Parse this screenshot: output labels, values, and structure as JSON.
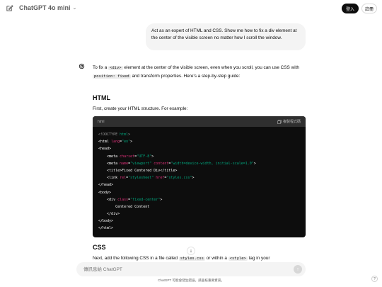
{
  "header": {
    "model_name": "ChatGPT 4o mini",
    "login_label": "登入",
    "signup_label": "註冊"
  },
  "user_message": "Act as an expert of HTML and CSS. Show me how to fix a div element at the center of the visible screen no matter how I scroll the window.",
  "answer": {
    "intro_1": "To fix a ",
    "intro_code_1": "<div>",
    "intro_2": " element at the center of the visible screen, even when you scroll, you can use CSS with ",
    "intro_code_2": "position: fixed",
    "intro_3": " and transform properties. Here's a step-by-step guide:",
    "html_heading": "HTML",
    "html_text": "First, create your HTML structure. For example:",
    "code_lang": "html",
    "copy_label": "複製程式碼",
    "css_heading": "CSS",
    "css_text_1": "Next, add the following CSS in a file called ",
    "css_code_1": "styles.css",
    "css_text_2": " or within a ",
    "css_code_2": "<style>",
    "css_text_3": " tag in your"
  },
  "code_lines": [
    [
      {
        "t": "<!DOCTYPE ",
        "c": "doc"
      },
      {
        "t": "html",
        "c": "val"
      },
      {
        "t": ">",
        "c": "doc"
      }
    ],
    [
      {
        "t": "<html ",
        "c": "tag"
      },
      {
        "t": "lang",
        "c": "attr"
      },
      {
        "t": "=",
        "c": "tag"
      },
      {
        "t": "\"en\"",
        "c": "val"
      },
      {
        "t": ">",
        "c": "tag"
      }
    ],
    [
      {
        "t": "<head>",
        "c": "tag"
      }
    ],
    [
      {
        "t": "    <meta ",
        "c": "tag"
      },
      {
        "t": "charset",
        "c": "attr"
      },
      {
        "t": "=",
        "c": "tag"
      },
      {
        "t": "\"UTF-8\"",
        "c": "val"
      },
      {
        "t": ">",
        "c": "tag"
      }
    ],
    [
      {
        "t": "    <meta ",
        "c": "tag"
      },
      {
        "t": "name",
        "c": "attr"
      },
      {
        "t": "=",
        "c": "tag"
      },
      {
        "t": "\"viewport\" ",
        "c": "val"
      },
      {
        "t": "content",
        "c": "attr"
      },
      {
        "t": "=",
        "c": "tag"
      },
      {
        "t": "\"width=device-width, initial-scale=1.0\"",
        "c": "val"
      },
      {
        "t": ">",
        "c": "tag"
      }
    ],
    [
      {
        "t": "    <title>",
        "c": "tag"
      },
      {
        "t": "Fixed Centered Div",
        "c": "txt"
      },
      {
        "t": "</title>",
        "c": "tag"
      }
    ],
    [
      {
        "t": "    <link ",
        "c": "tag"
      },
      {
        "t": "rel",
        "c": "attr"
      },
      {
        "t": "=",
        "c": "tag"
      },
      {
        "t": "\"stylesheet\" ",
        "c": "val"
      },
      {
        "t": "href",
        "c": "attr"
      },
      {
        "t": "=",
        "c": "tag"
      },
      {
        "t": "\"styles.css\"",
        "c": "val"
      },
      {
        "t": ">",
        "c": "tag"
      }
    ],
    [
      {
        "t": "</head>",
        "c": "tag"
      }
    ],
    [
      {
        "t": "<body>",
        "c": "tag"
      }
    ],
    [
      {
        "t": "    <div ",
        "c": "tag"
      },
      {
        "t": "class",
        "c": "attr"
      },
      {
        "t": "=",
        "c": "tag"
      },
      {
        "t": "\"fixed-center\"",
        "c": "val"
      },
      {
        "t": ">",
        "c": "tag"
      }
    ],
    [
      {
        "t": "        Centered Content",
        "c": "txt"
      }
    ],
    [
      {
        "t": "    </div>",
        "c": "tag"
      }
    ],
    [
      {
        "t": "</body>",
        "c": "tag"
      }
    ],
    [
      {
        "t": "</html>",
        "c": "tag"
      }
    ]
  ],
  "composer": {
    "placeholder": "傳訊息給 ChatGPT"
  },
  "footer": "ChatGPT 可能會發生錯誤。請查核重要資訊。",
  "help_label": "?"
}
